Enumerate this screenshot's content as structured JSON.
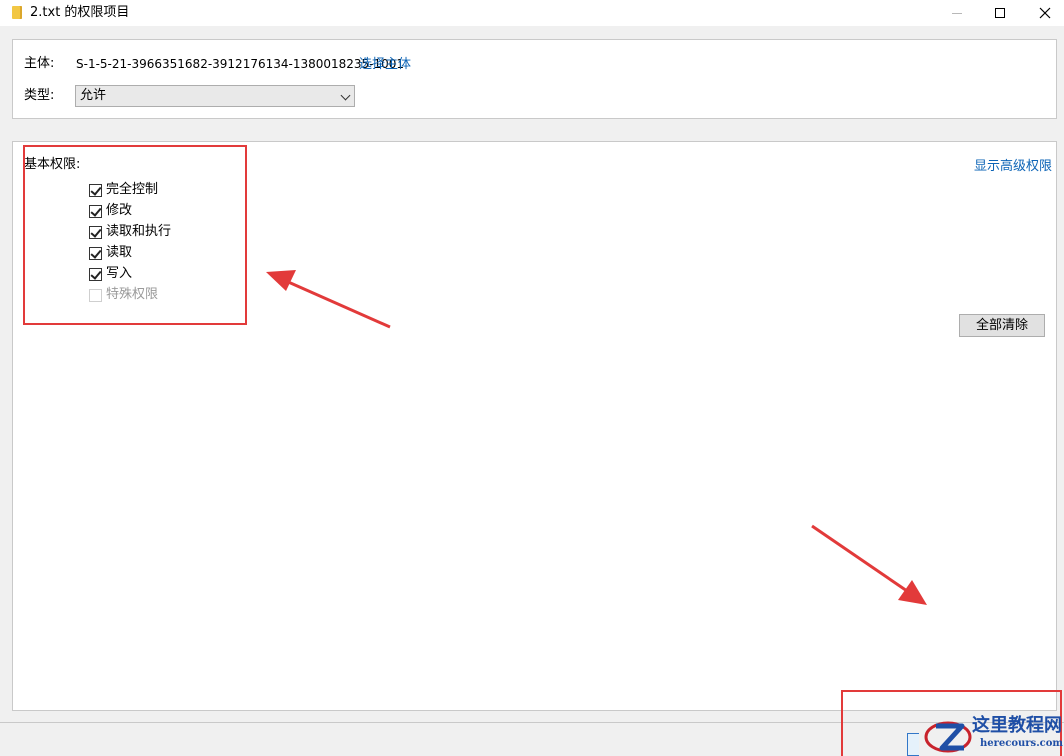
{
  "window": {
    "title": "2.txt 的权限项目",
    "icon": "folder-icon"
  },
  "principal": {
    "label": "主体:",
    "value": "S-1-5-21-3966351682-3912176134-1380018235-1001",
    "select_link": "选择主体"
  },
  "type": {
    "label": "类型:",
    "selected": "允许"
  },
  "permissions": {
    "heading": "基本权限:",
    "show_advanced": "显示高级权限",
    "items": [
      {
        "label": "完全控制",
        "checked": true,
        "enabled": true
      },
      {
        "label": "修改",
        "checked": true,
        "enabled": true
      },
      {
        "label": "读取和执行",
        "checked": true,
        "enabled": true
      },
      {
        "label": "读取",
        "checked": true,
        "enabled": true
      },
      {
        "label": "写入",
        "checked": true,
        "enabled": true
      },
      {
        "label": "特殊权限",
        "checked": false,
        "enabled": false
      }
    ],
    "clear_all": "全部清除"
  },
  "watermark": {
    "title": "这里教程网",
    "url": "herecours.com"
  },
  "colors": {
    "annotation": "#e23a3a",
    "link": "#0b63b6",
    "watermark": "#1f4fa6"
  }
}
